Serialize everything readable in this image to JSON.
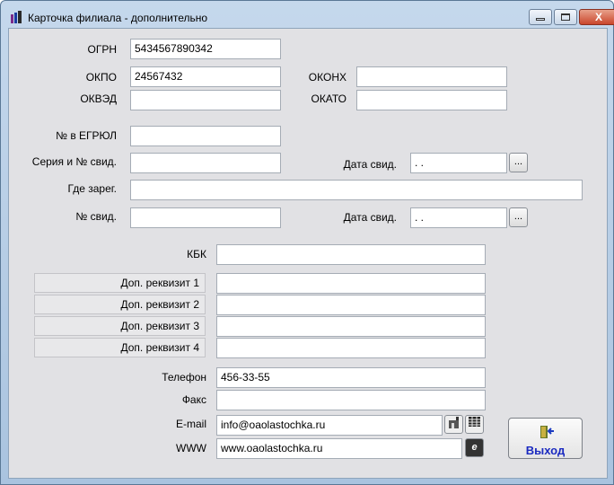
{
  "window": {
    "title": "Карточка филиала - дополнительно",
    "close": "X"
  },
  "fields": {
    "ogrn": {
      "label": "ОГРН",
      "value": "5434567890342"
    },
    "okpo": {
      "label": "ОКПО",
      "value": "24567432"
    },
    "okonh": {
      "label": "ОКОНХ",
      "value": ""
    },
    "okved": {
      "label": "ОКВЭД",
      "value": ""
    },
    "okato": {
      "label": "ОКАТО",
      "value": ""
    },
    "egrul": {
      "label": "№ в ЕГРЮЛ",
      "value": ""
    },
    "series": {
      "label": "Серия и № свид.",
      "value": ""
    },
    "date1": {
      "label": "Дата свид.",
      "value": " .  ."
    },
    "where": {
      "label": "Где зарег.",
      "value": ""
    },
    "cert_no": {
      "label": "№ свид.",
      "value": ""
    },
    "date2": {
      "label": "Дата свид.",
      "value": " .  ."
    },
    "kbk": {
      "label": "КБК",
      "value": ""
    },
    "phone": {
      "label": "Телефон",
      "value": "456-33-55"
    },
    "fax": {
      "label": "Факс",
      "value": ""
    },
    "email": {
      "label": "E-mail",
      "value": "info@oaolastochka.ru"
    },
    "www": {
      "label": "WWW",
      "value": "www.oaolastochka.ru"
    }
  },
  "extra": [
    {
      "label": "Доп. реквизит 1",
      "value": ""
    },
    {
      "label": "Доп. реквизит 2",
      "value": ""
    },
    {
      "label": "Доп. реквизит 3",
      "value": ""
    },
    {
      "label": "Доп. реквизит 4",
      "value": ""
    }
  ],
  "buttons": {
    "ellipsis": "...",
    "exit": "Выход"
  }
}
